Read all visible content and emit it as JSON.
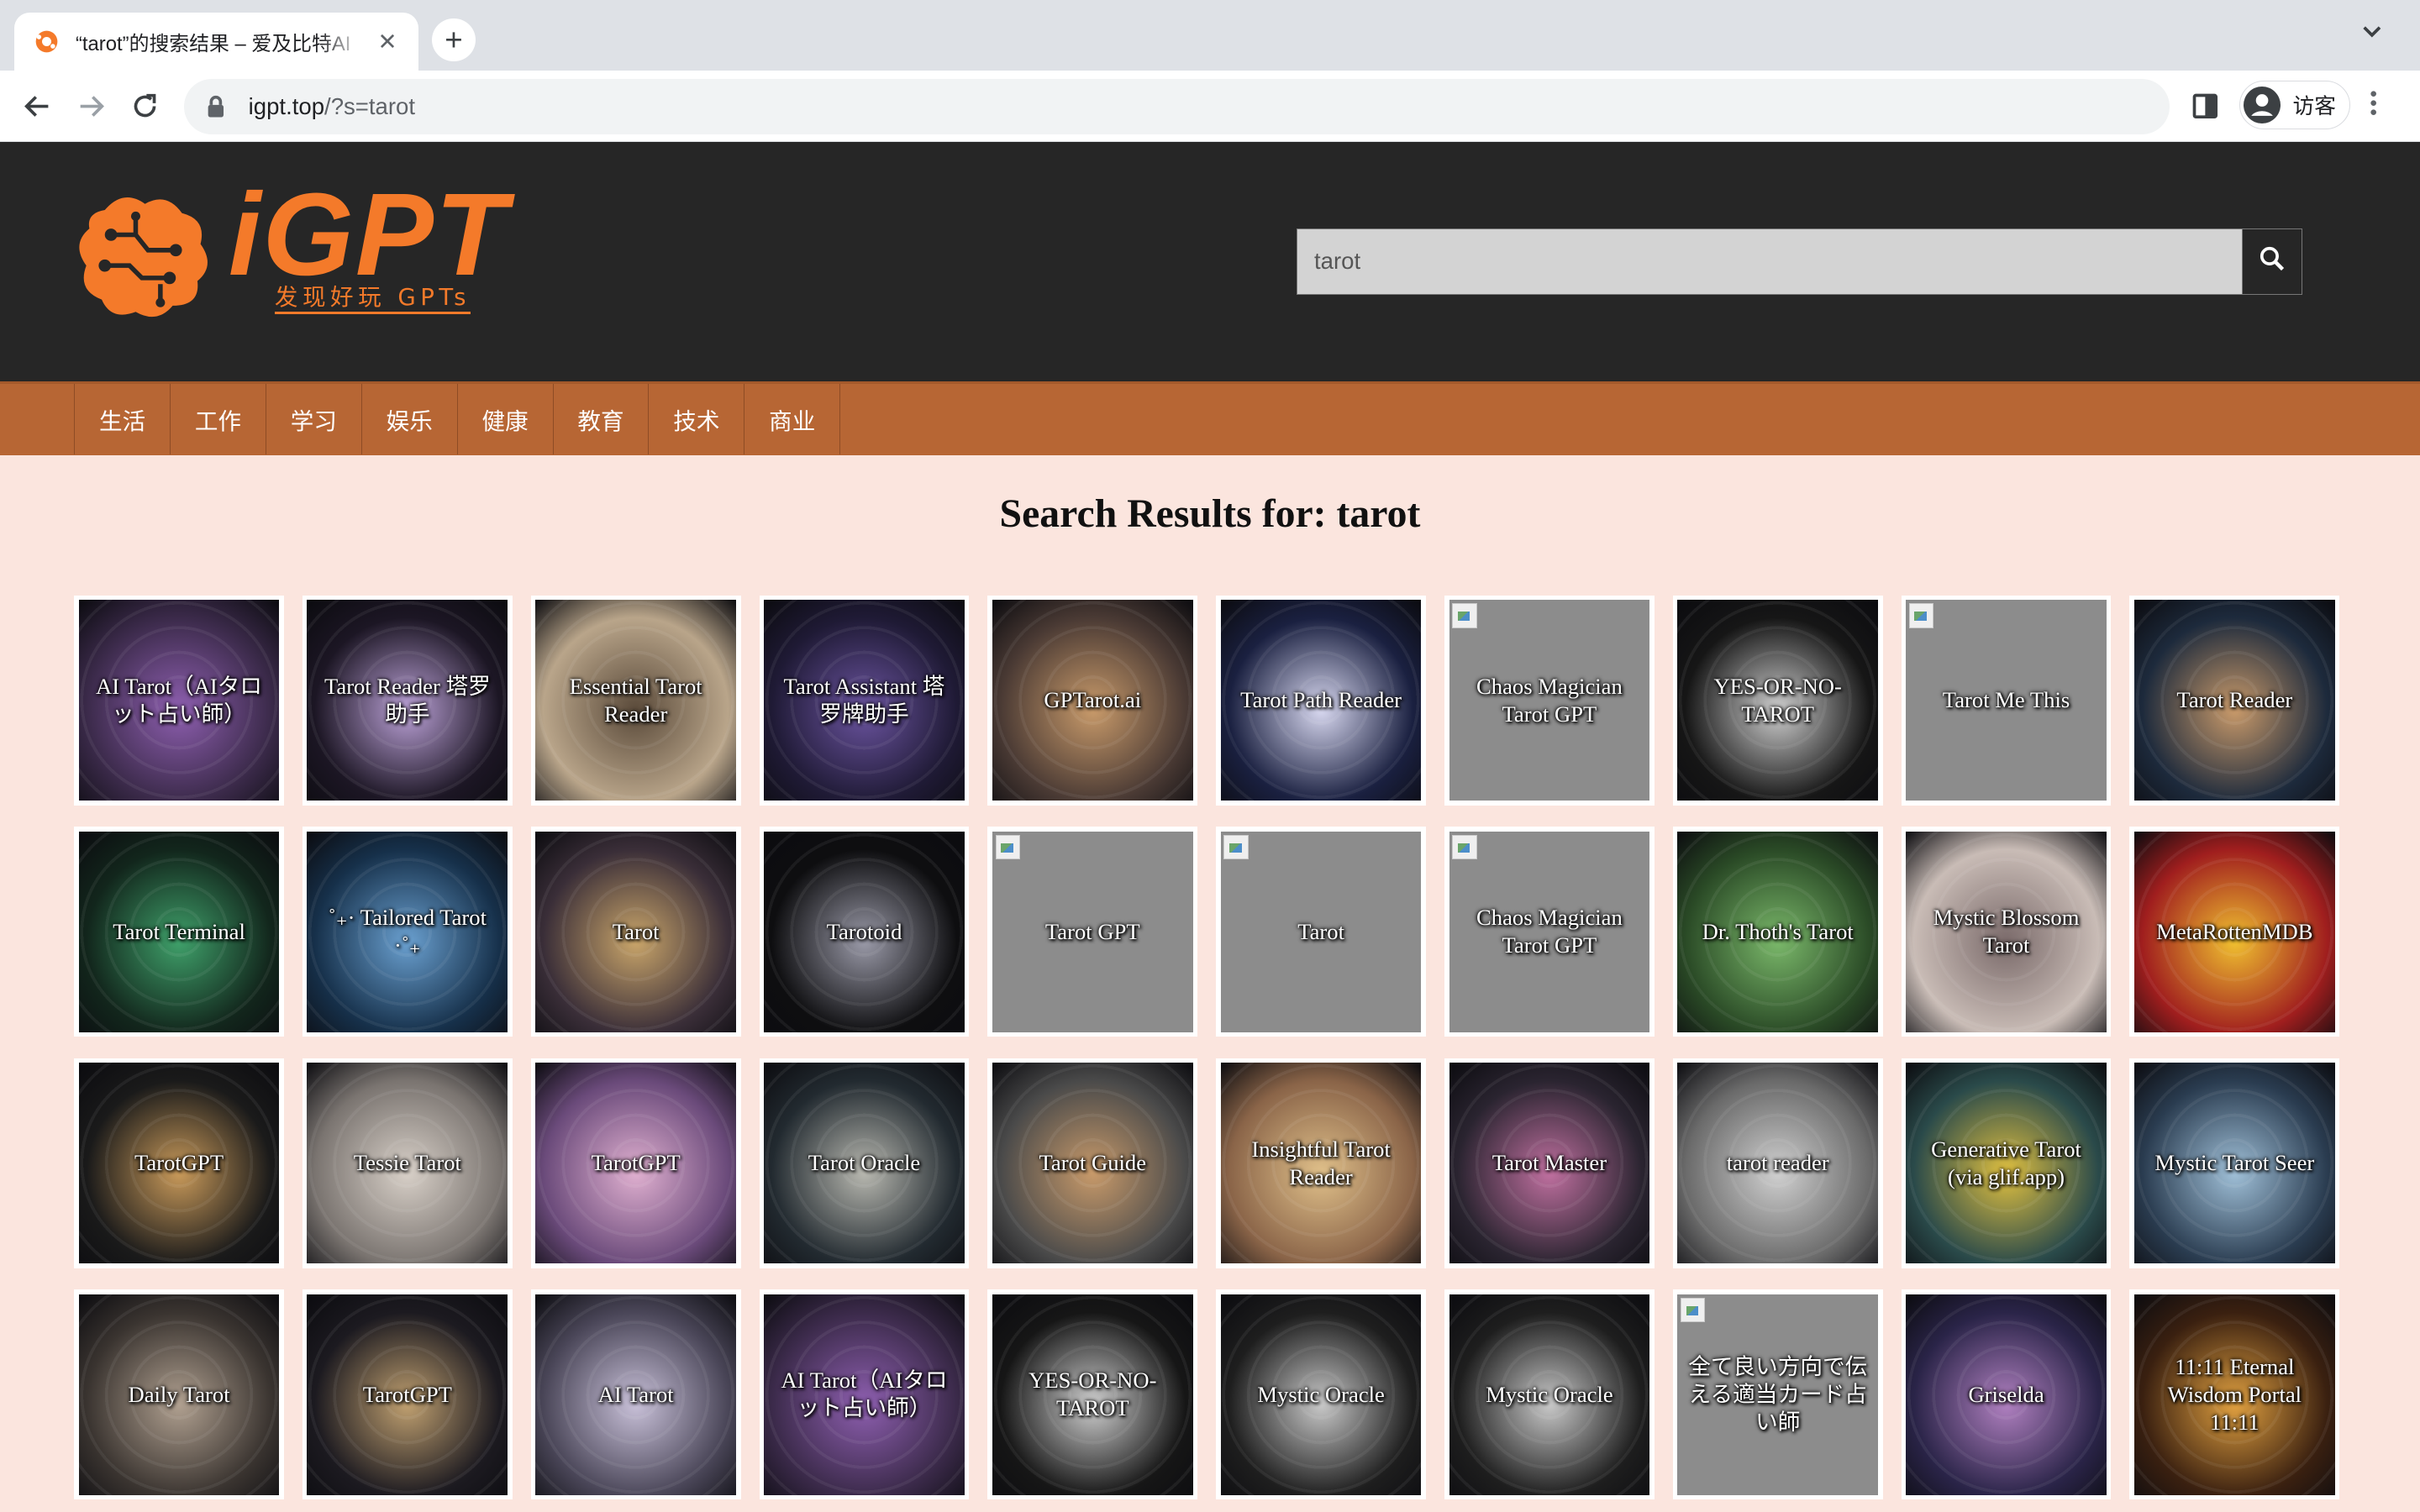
{
  "browser": {
    "tab_title": "“tarot”的搜索结果 – 爱及比特AI",
    "url_host": "igpt.top",
    "url_path": "/?s=tarot",
    "profile_name": "访客"
  },
  "site": {
    "logo_text": "iGPT",
    "logo_tagline": "发现好玩 GPTs",
    "search_value": "tarot",
    "nav": [
      "生活",
      "工作",
      "学习",
      "娱乐",
      "健康",
      "教育",
      "技术",
      "商业"
    ]
  },
  "results": {
    "heading": "Search Results for: tarot",
    "items": [
      {
        "label": "AI Tarot（AIタロット占い師）",
        "bg": "#3b2a4a",
        "accent": "#8e5fb0",
        "broken": false
      },
      {
        "label": "Tarot Reader 塔罗助手",
        "bg": "#1c1624",
        "accent": "#bca2d8",
        "broken": false
      },
      {
        "label": "Essential Tarot Reader",
        "bg": "#b9a58a",
        "accent": "#5a4a3a",
        "broken": false
      },
      {
        "label": "Tarot Assistant 塔罗牌助手",
        "bg": "#1f1a35",
        "accent": "#6b54a0",
        "broken": false
      },
      {
        "label": "GPTarot.ai",
        "bg": "#4a3a34",
        "accent": "#c89a6a",
        "broken": false
      },
      {
        "label": "Tarot Path Reader",
        "bg": "#1a2040",
        "accent": "#d8d8f0",
        "broken": false
      },
      {
        "label": "Chaos Magician Tarot GPT",
        "bg": "#8a8a8a",
        "accent": "#8a8a8a",
        "broken": true
      },
      {
        "label": "YES-OR-NO-TAROT",
        "bg": "#161616",
        "accent": "#cfcfcf",
        "broken": false
      },
      {
        "label": "Tarot Me This",
        "bg": "#8a8a8a",
        "accent": "#8a8a8a",
        "broken": true
      },
      {
        "label": "Tarot Reader",
        "bg": "#1d2a3c",
        "accent": "#c99a6a",
        "broken": false
      },
      {
        "label": "Tarot Terminal",
        "bg": "#12261c",
        "accent": "#3fa06a",
        "broken": false
      },
      {
        "label": "˚₊· Tailored Tarot ·˚₊",
        "bg": "#16304a",
        "accent": "#6aa0d0",
        "broken": false
      },
      {
        "label": "Tarot",
        "bg": "#3a2e38",
        "accent": "#c9a56a",
        "broken": false
      },
      {
        "label": "Tarotoid",
        "bg": "#0e0e10",
        "accent": "#9a9aa8",
        "broken": false
      },
      {
        "label": "Tarot GPT",
        "bg": "#8a8a8a",
        "accent": "#8a8a8a",
        "broken": true
      },
      {
        "label": "Tarot",
        "bg": "#8a8a8a",
        "accent": "#8a8a8a",
        "broken": true
      },
      {
        "label": "Chaos Magician Tarot GPT",
        "bg": "#8a8a8a",
        "accent": "#8a8a8a",
        "broken": true
      },
      {
        "label": "Dr. Thoth's Tarot",
        "bg": "#2a4a26",
        "accent": "#7ab86a",
        "broken": false
      },
      {
        "label": "Mystic Blossom Tarot",
        "bg": "#c9bcb6",
        "accent": "#7a6a6a",
        "broken": false
      },
      {
        "label": "MetaRottenMDB",
        "bg": "#a01e1e",
        "accent": "#f0c030",
        "broken": false
      },
      {
        "label": "TarotGPT",
        "bg": "#1a1a1a",
        "accent": "#c99a5a",
        "broken": false
      },
      {
        "label": "Tessie Tarot",
        "bg": "#7a7470",
        "accent": "#d8d0c8",
        "broken": false
      },
      {
        "label": "TarotGPT",
        "bg": "#6a4a7a",
        "accent": "#e0b0d0",
        "broken": false
      },
      {
        "label": "Tarot Oracle",
        "bg": "#222a30",
        "accent": "#b8b8b0",
        "broken": false
      },
      {
        "label": "Tarot Guide",
        "bg": "#4a4a4a",
        "accent": "#c89a6a",
        "broken": false
      },
      {
        "label": "Insightful Tarot Reader",
        "bg": "#8a6448",
        "accent": "#e0c08a",
        "broken": false
      },
      {
        "label": "Tarot Master",
        "bg": "#2a2430",
        "accent": "#c070a0",
        "broken": false
      },
      {
        "label": "tarot reader",
        "bg": "#6a6a6a",
        "accent": "#d0d0d0",
        "broken": false
      },
      {
        "label": "Generative Tarot (via glif.app)",
        "bg": "#2a4a4a",
        "accent": "#e0c040",
        "broken": false
      },
      {
        "label": "Mystic Tarot Seer",
        "bg": "#2a3c50",
        "accent": "#a0c0d8",
        "broken": false
      },
      {
        "label": "Daily Tarot",
        "bg": "#3a3430",
        "accent": "#b0a090",
        "broken": false
      },
      {
        "label": "TarotGPT",
        "bg": "#1c1a20",
        "accent": "#c0a070",
        "broken": false
      },
      {
        "label": "AI Tarot",
        "bg": "#4a4658",
        "accent": "#c8c0d8",
        "broken": false
      },
      {
        "label": "AI Tarot（AIタロット占い師）",
        "bg": "#3b2a4a",
        "accent": "#8e5fb0",
        "broken": false
      },
      {
        "label": "YES-OR-NO-TAROT",
        "bg": "#161616",
        "accent": "#cfcfcf",
        "broken": false
      },
      {
        "label": "Mystic Oracle",
        "bg": "#1e1e1e",
        "accent": "#c8c8c8",
        "broken": false
      },
      {
        "label": "Mystic Oracle",
        "bg": "#1e1e1e",
        "accent": "#c8c8c8",
        "broken": false
      },
      {
        "label": "全て良い方向で伝える適当カード占い師",
        "bg": "#8a8a8a",
        "accent": "#8a8a8a",
        "broken": true
      },
      {
        "label": "Griselda",
        "bg": "#2a2448",
        "accent": "#b080c0",
        "broken": false
      },
      {
        "label": "11:11 Eternal Wisdom Portal 11:11",
        "bg": "#3a2010",
        "accent": "#e0a040",
        "broken": false
      }
    ]
  },
  "colors": {
    "header_bg": "#262626",
    "nav_bg": "#b76634",
    "page_bg": "#fbe5de",
    "logo_orange": "#f47a2a"
  }
}
